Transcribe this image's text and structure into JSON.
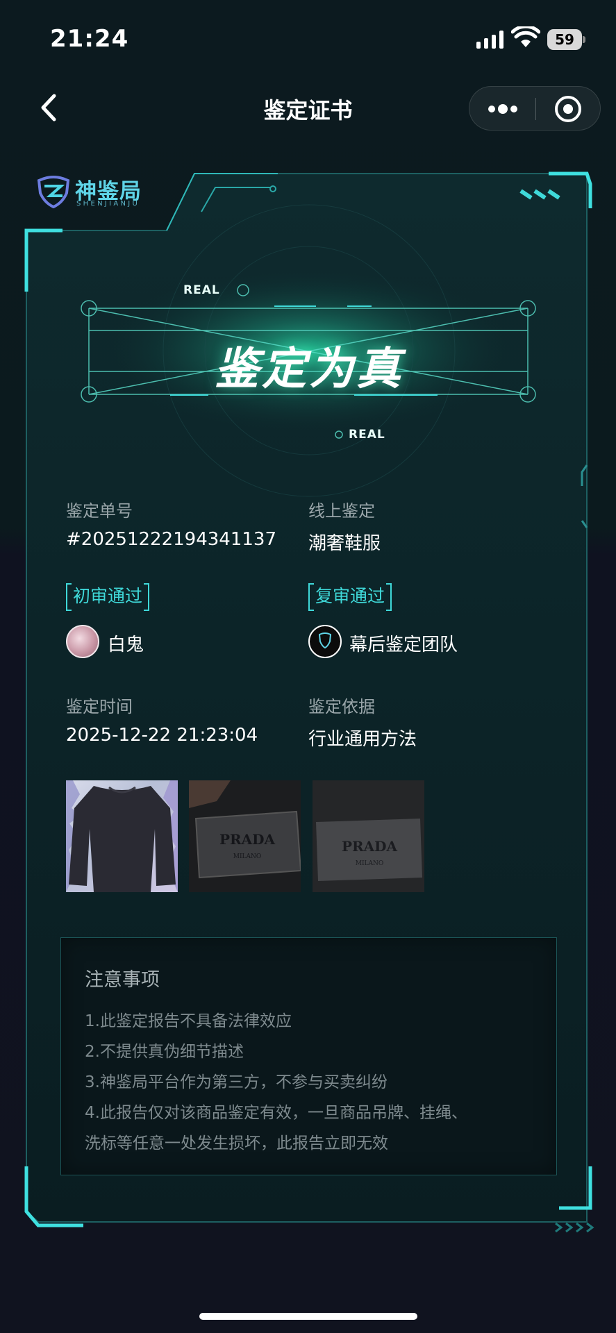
{
  "status_bar": {
    "time": "21:24",
    "battery": "59"
  },
  "nav": {
    "title": "鉴定证书"
  },
  "logo": {
    "cn": "神鉴局",
    "en": "SHENJIANJU"
  },
  "verdict": {
    "text": "鉴定为真",
    "badge_top": "REAL",
    "badge_bottom": "REAL"
  },
  "info": {
    "order_label": "鉴定单号",
    "order_value": "#20251222194341137",
    "type_label": "线上鉴定",
    "type_value": "潮奢鞋服",
    "first_review_tag": "初审通过",
    "first_reviewer": "白鬼",
    "second_review_tag": "复审通过",
    "second_reviewer": "幕后鉴定团队",
    "time_label": "鉴定时间",
    "time_value": "2025-12-22 21:23:04",
    "basis_label": "鉴定依据",
    "basis_value": "行业通用方法"
  },
  "photos": [
    {
      "icon": "sweater-photo"
    },
    {
      "icon": "label-photo",
      "label_text": "PRADA",
      "label_sub": "MILANO"
    },
    {
      "icon": "label-photo",
      "label_text": "PRADA",
      "label_sub": "MILANO"
    }
  ],
  "notice": {
    "title": "注意事项",
    "lines": [
      "1.此鉴定报告不具备法律效应",
      "2.不提供真伪细节描述",
      "3.神鉴局平台作为第三方，不参与买卖纠纷",
      "4.此报告仅对该商品鉴定有效，一旦商品吊牌、挂绳、",
      "洗标等任意一处发生损坏，此报告立即无效"
    ]
  },
  "colors": {
    "accent": "#3fd9d9",
    "background": "#0c1a1f",
    "glow": "#2ee6b0"
  }
}
